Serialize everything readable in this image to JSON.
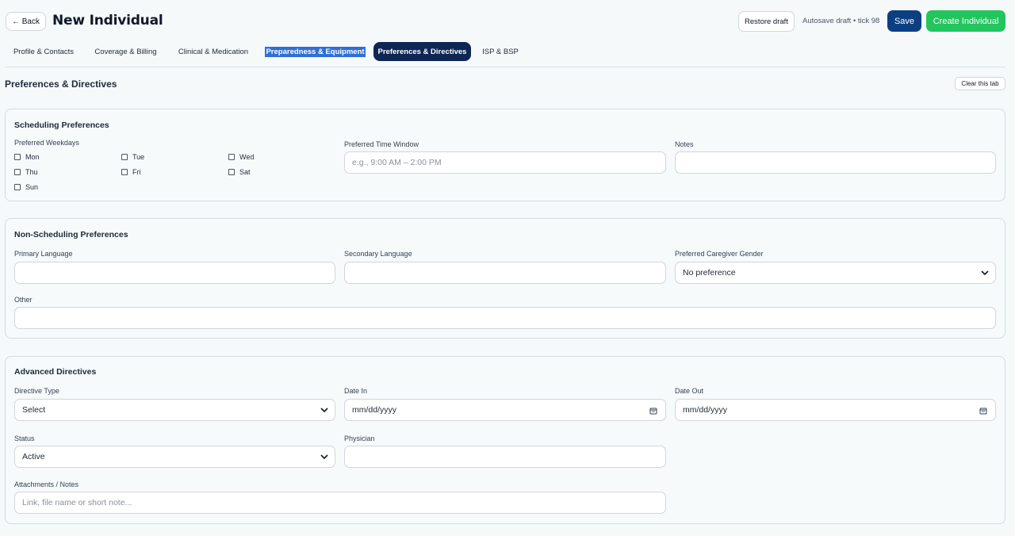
{
  "header": {
    "back_label": "← Back",
    "title": "New Individual",
    "restore_label": "Restore draft",
    "autosave_text": "Autosave draft • tick 98",
    "save_label": "Save",
    "create_label": "Create Individual"
  },
  "tabs": [
    {
      "label": "Profile & Contacts"
    },
    {
      "label": "Coverage & Billing"
    },
    {
      "label": "Clinical & Medication"
    },
    {
      "label": "Preparedness & Equipment"
    },
    {
      "label": "Preferences & Directives"
    },
    {
      "label": "ISP & BSP"
    }
  ],
  "active_tab": "Preferences & Directives",
  "section": {
    "title": "Preferences & Directives",
    "clear_label": "Clear this tab"
  },
  "scheduling": {
    "title": "Scheduling Preferences",
    "weekdays_label": "Preferred Weekdays",
    "days": [
      "Mon",
      "Tue",
      "Wed",
      "Thu",
      "Fri",
      "Sat",
      "Sun"
    ],
    "time_window_label": "Preferred Time Window",
    "time_window_placeholder": "e.g., 9:00 AM – 2:00 PM",
    "notes_label": "Notes",
    "notes_value": ""
  },
  "non_scheduling": {
    "title": "Non-Scheduling Preferences",
    "primary_language_label": "Primary Language",
    "secondary_language_label": "Secondary Language",
    "caregiver_gender_label": "Preferred Caregiver Gender",
    "caregiver_gender_value": "No preference",
    "other_label": "Other"
  },
  "directives": {
    "title": "Advanced Directives",
    "type_label": "Directive Type",
    "type_value": "Select",
    "date_in_label": "Date In",
    "date_in_value": "mm/dd/yyyy",
    "date_out_label": "Date Out",
    "date_out_value": "mm/dd/yyyy",
    "status_label": "Status",
    "status_value": "Active",
    "physician_label": "Physician",
    "attachments_label": "Attachments / Notes",
    "attachments_placeholder": "Link, file name or short note..."
  },
  "colors": {
    "primary": "#0b3f82",
    "success": "#22c55e",
    "active_tab": "#0e2654",
    "highlight": "#2f6fd6"
  }
}
